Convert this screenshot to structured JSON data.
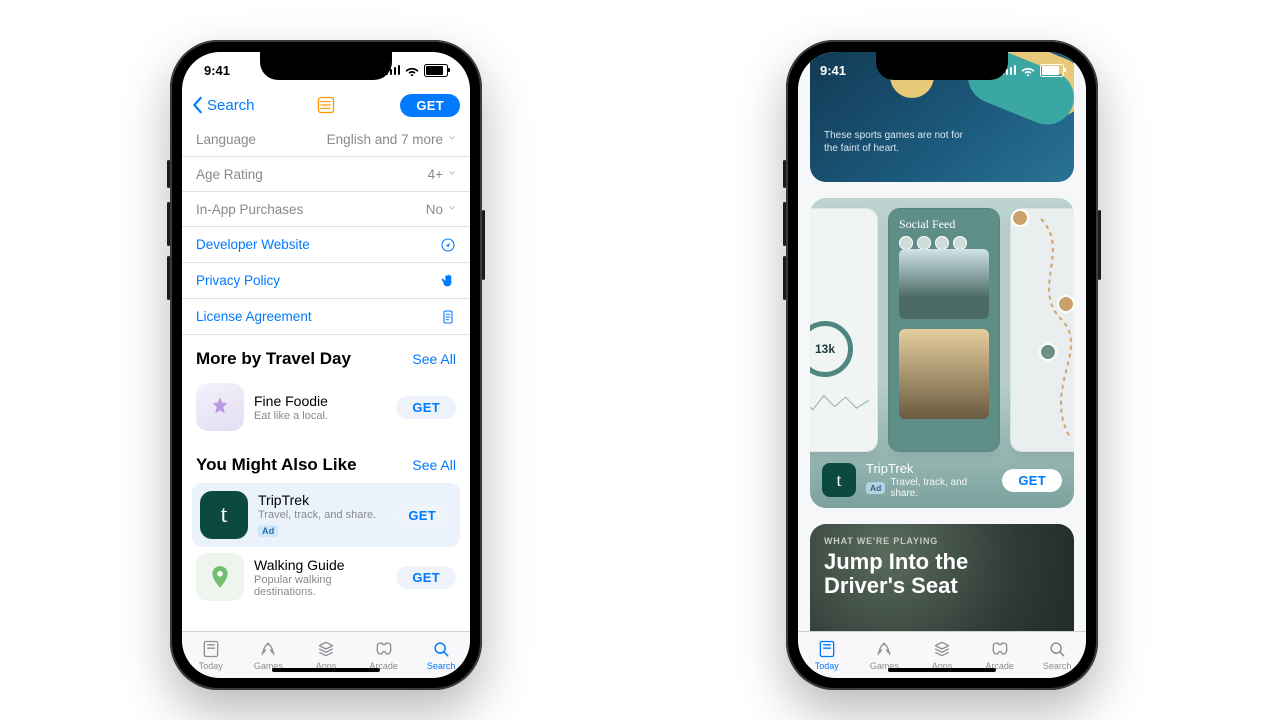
{
  "status": {
    "time": "9:41"
  },
  "left": {
    "nav": {
      "back": "Search",
      "get": "GET"
    },
    "rows": [
      {
        "label": "Language",
        "value": "English and 7 more",
        "link": false,
        "icon": ""
      },
      {
        "label": "Age Rating",
        "value": "4+",
        "link": false,
        "icon": ""
      },
      {
        "label": "In-App Purchases",
        "value": "No",
        "link": false,
        "icon": ""
      },
      {
        "label": "Developer Website",
        "value": "",
        "link": true,
        "icon": "compass"
      },
      {
        "label": "Privacy Policy",
        "value": "",
        "link": true,
        "icon": "hand"
      },
      {
        "label": "License Agreement",
        "value": "",
        "link": true,
        "icon": "doc"
      }
    ],
    "more": {
      "heading": "More by Travel Day",
      "see_all": "See All",
      "app": {
        "title": "Fine Foodie",
        "subtitle": "Eat like a local.",
        "get": "GET"
      }
    },
    "also": {
      "heading": "You Might Also Like",
      "see_all": "See All",
      "apps": [
        {
          "title": "TripTrek",
          "subtitle": "Travel, track, and share.",
          "get": "GET",
          "ad": "Ad"
        },
        {
          "title": "Walking Guide",
          "subtitle": "Popular walking destinations.",
          "get": "GET",
          "ad": ""
        }
      ]
    },
    "tabs": [
      "Today",
      "Games",
      "Apps",
      "Arcade",
      "Search"
    ],
    "active_tab": 4
  },
  "right": {
    "hero_caption": "These sports games are not for the faint of heart.",
    "ad": {
      "feed_title": "Social Feed",
      "ring": "13k",
      "title": "TripTrek",
      "subtitle": "Travel, track, and share.",
      "ad_badge": "Ad",
      "get": "GET"
    },
    "story": {
      "eyebrow": "WHAT WE'RE PLAYING",
      "title_l1": "Jump Into the",
      "title_l2": "Driver's Seat"
    },
    "tabs": [
      "Today",
      "Games",
      "Apps",
      "Arcade",
      "Search"
    ],
    "active_tab": 0
  }
}
